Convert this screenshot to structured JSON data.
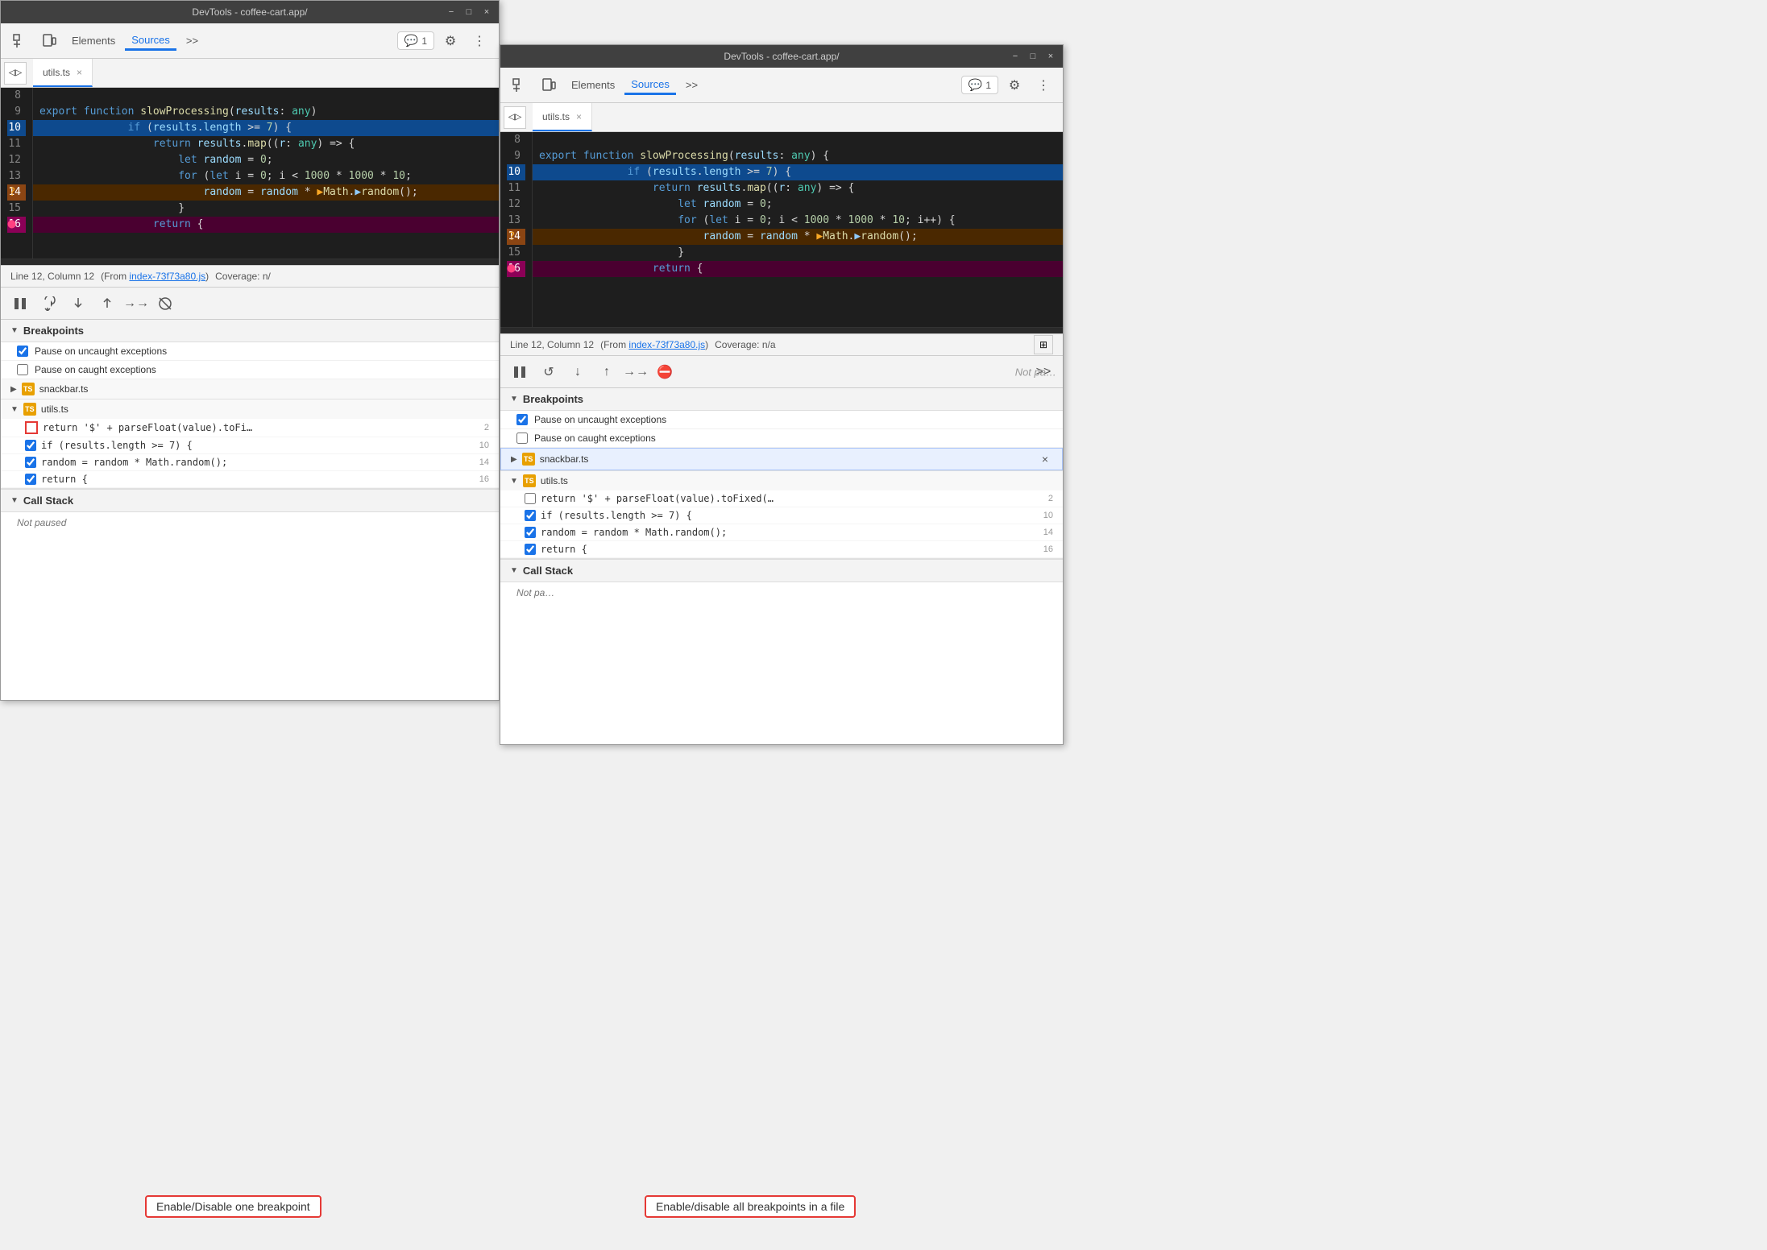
{
  "window1": {
    "titleBar": {
      "title": "DevTools - coffee-cart.app/",
      "minimize": "−",
      "restore": "□",
      "close": "×"
    },
    "toolbar": {
      "elements_label": "Elements",
      "sources_label": "Sources",
      "more_label": ">>",
      "console_count": "1"
    },
    "fileTab": {
      "filename": "utils.ts",
      "close": "×"
    },
    "code": {
      "lines": [
        {
          "num": "8",
          "text": "",
          "highlight": "none"
        },
        {
          "num": "9",
          "text": "export function slowProcessing(results: any)",
          "highlight": "none"
        },
        {
          "num": "10",
          "text": "    if (results.length >= 7) {",
          "highlight": "blue"
        },
        {
          "num": "11",
          "text": "        return results.map((r: any) => {",
          "highlight": "none"
        },
        {
          "num": "12",
          "text": "            let random = 0;",
          "highlight": "none"
        },
        {
          "num": "13",
          "text": "            for (let i = 0; i < 1000 * 1000 * 10;",
          "highlight": "none"
        },
        {
          "num": "14",
          "text": "                random = random * ▶Math.▶random();",
          "highlight": "orange"
        },
        {
          "num": "15",
          "text": "            }",
          "highlight": "none"
        },
        {
          "num": "16",
          "text": "        return {",
          "highlight": "pink"
        }
      ]
    },
    "statusBar": {
      "position": "Line 12, Column 12",
      "from_label": "(From",
      "source_file": "index-73f73a80.js",
      "coverage": "Coverage: n/"
    },
    "debugToolbar": {
      "pause": "⏸",
      "step_over": "↺",
      "step_into": "↓",
      "step_out": "↑",
      "step": "→→",
      "deactivate": "⛔"
    },
    "breakpoints": {
      "section_label": "Breakpoints",
      "pause_uncaught": "Pause on uncaught exceptions",
      "pause_caught": "Pause on caught exceptions",
      "files": [
        {
          "name": "snackbar.ts",
          "expanded": false,
          "entries": []
        },
        {
          "name": "utils.ts",
          "expanded": true,
          "entries": [
            {
              "text": "return '$' + parseFloat(value).toFi…",
              "line": "2",
              "checked": false,
              "highlighted": true
            },
            {
              "text": "if (results.length >= 7) {",
              "line": "10",
              "checked": true
            },
            {
              "text": "random = random * Math.random();",
              "line": "14",
              "checked": true
            },
            {
              "text": "return {",
              "line": "16",
              "checked": true
            }
          ]
        }
      ]
    },
    "callStack": {
      "label": "Call Stack",
      "not_paused": "Not paused"
    }
  },
  "window2": {
    "titleBar": {
      "title": "DevTools - coffee-cart.app/",
      "minimize": "−",
      "restore": "□",
      "close": "×"
    },
    "toolbar": {
      "elements_label": "Elements",
      "sources_label": "Sources",
      "more_label": ">>",
      "console_count": "1"
    },
    "fileTab": {
      "filename": "utils.ts",
      "close": "×"
    },
    "code": {
      "lines": [
        {
          "num": "8",
          "text": "",
          "highlight": "none"
        },
        {
          "num": "9",
          "text": "export function slowProcessing(results: any) {",
          "highlight": "none"
        },
        {
          "num": "10",
          "text": "    if (results.length >= 7) {",
          "highlight": "blue"
        },
        {
          "num": "11",
          "text": "        return results.map((r: any) => {",
          "highlight": "none"
        },
        {
          "num": "12",
          "text": "            let random = 0;",
          "highlight": "none"
        },
        {
          "num": "13",
          "text": "            for (let i = 0; i < 1000 * 1000 * 10; i++) {",
          "highlight": "none"
        },
        {
          "num": "14",
          "text": "                random = random * ▶Math.▶random();",
          "highlight": "orange"
        },
        {
          "num": "15",
          "text": "            }",
          "highlight": "none"
        },
        {
          "num": "16",
          "text": "        return {",
          "highlight": "pink"
        }
      ]
    },
    "statusBar": {
      "position": "Line 12, Column 12",
      "from_label": "(From",
      "source_file": "index-73f73a80.js",
      "coverage": "Coverage: n/a"
    },
    "breakpoints": {
      "section_label": "Breakpoints",
      "pause_uncaught": "Pause on uncaught exceptions",
      "pause_caught": "Pause on caught exceptions",
      "files": [
        {
          "name": "snackbar.ts",
          "expanded": false,
          "highlighted": true,
          "entries": []
        },
        {
          "name": "utils.ts",
          "expanded": true,
          "highlighted": false,
          "entries": [
            {
              "text": "return '$' + parseFloat(value).toFixed(…",
              "line": "2",
              "checked": false
            },
            {
              "text": "if (results.length >= 7) {",
              "line": "10",
              "checked": true
            },
            {
              "text": "random = random * Math.random();",
              "line": "14",
              "checked": true
            },
            {
              "text": "return {",
              "line": "16",
              "checked": true
            }
          ]
        }
      ]
    },
    "callStack": {
      "label": "Call Stack",
      "not_paused": "Not pa…"
    },
    "not_paused_panel": "Not pa…"
  },
  "annotations": {
    "annotation1": "Enable/Disable one breakpoint",
    "annotation2": "Enable/disable all breakpoints in a file"
  }
}
